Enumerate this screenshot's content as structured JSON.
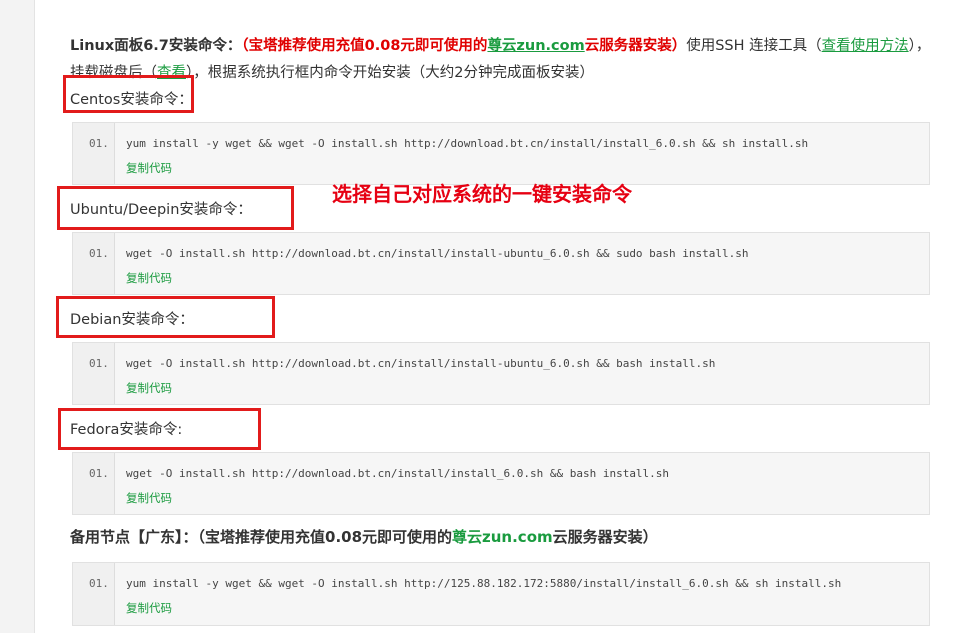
{
  "intro": {
    "title": "Linux面板6.7安装命令：",
    "red_prefix": "（宝塔推荐使用充值0.08元即可使用的",
    "brand_link": "尊云zun.com",
    "red_suffix": "云服务器安装）",
    "text_1": "使用SSH 连接工具（",
    "link_usage": "查看使用方法",
    "text_2": "），挂载磁盘后（",
    "link_view": "查看",
    "text_3": "），根据系统执行框内命令开始安装（大约2分钟完成面板安装）"
  },
  "sections": [
    {
      "title": "Centos安装命令：",
      "line_no": "01.",
      "command": "yum install -y wget && wget -O install.sh http://download.bt.cn/install/install_6.0.sh && sh install.sh",
      "copy_label": "复制代码"
    },
    {
      "title": "Ubuntu/Deepin安装命令：",
      "line_no": "01.",
      "command": "wget -O install.sh http://download.bt.cn/install/install-ubuntu_6.0.sh && sudo bash install.sh",
      "copy_label": "复制代码"
    },
    {
      "title": "Debian安装命令：",
      "line_no": "01.",
      "command": "wget -O install.sh http://download.bt.cn/install/install-ubuntu_6.0.sh && bash install.sh",
      "copy_label": "复制代码"
    },
    {
      "title": "Fedora安装命令:",
      "line_no": "01.",
      "command": "wget -O install.sh http://download.bt.cn/install/install_6.0.sh && bash install.sh",
      "copy_label": "复制代码"
    }
  ],
  "annotation": "选择自己对应系统的一键安装命令",
  "backup": {
    "prefix": "备用节点【广东】：（宝塔推荐使用充值0.08元即可使用的",
    "brand": "尊云zun.com",
    "suffix": "云服务器安装）",
    "line_no": "01.",
    "command": "yum install -y wget && wget -O install.sh http://125.88.182.172:5880/install/install_6.0.sh && sh install.sh",
    "copy_label": "复制代码"
  },
  "colors": {
    "accent_green": "#1a9b3f",
    "highlight_red": "#e21b1b",
    "annotation_red": "#e60012"
  }
}
